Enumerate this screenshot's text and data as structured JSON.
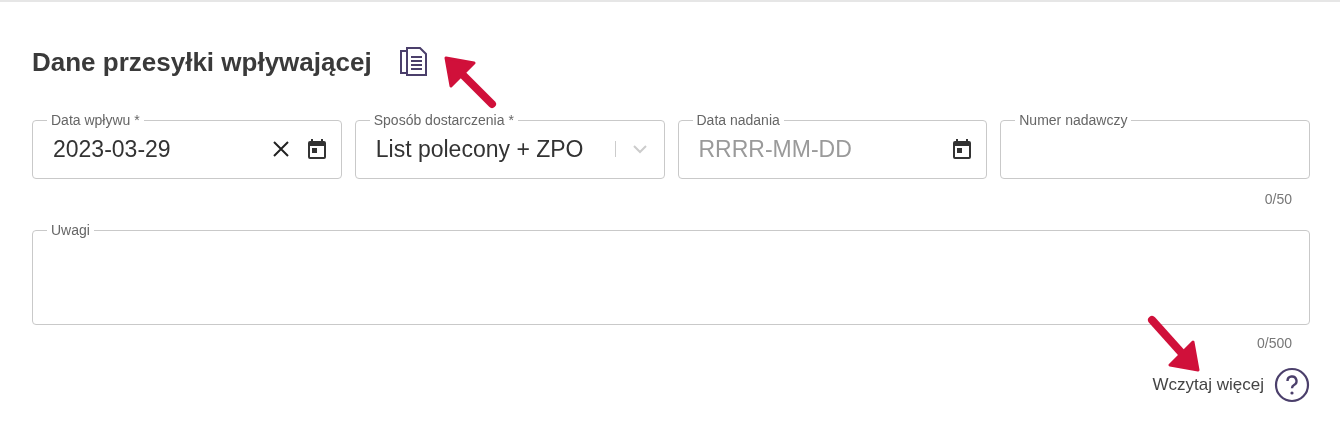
{
  "title": "Dane przesyłki wpływającej",
  "fields": [
    {
      "kind": "date",
      "label": "Data wpływu *",
      "value": "2023-03-29",
      "clearable": true
    },
    {
      "kind": "select",
      "label": "Sposób dostarczenia *",
      "value": "List polecony + ZPO"
    },
    {
      "kind": "date",
      "label": "Data nadania",
      "placeholder": "RRRR-MM-DD",
      "clearable": false
    },
    {
      "kind": "text",
      "label": "Numer nadawczy",
      "counter": "0/50"
    }
  ],
  "notes": {
    "label": "Uwagi",
    "counter": "0/500"
  },
  "load_more": {
    "label": "Wczytaj więcej"
  }
}
